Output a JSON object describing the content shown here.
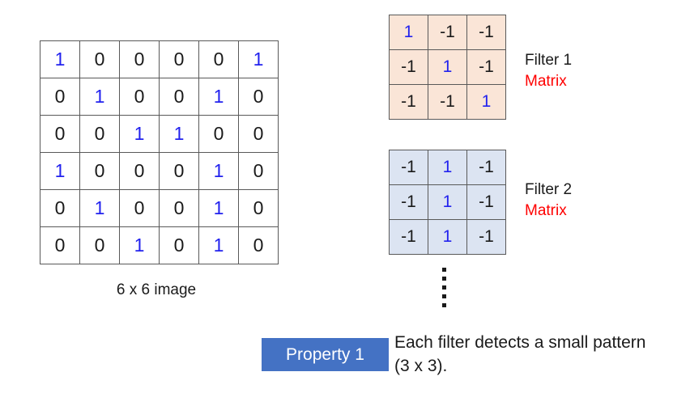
{
  "image_grid": {
    "caption": "6 x 6 image",
    "rows": [
      [
        "1",
        "0",
        "0",
        "0",
        "0",
        "1"
      ],
      [
        "0",
        "1",
        "0",
        "0",
        "1",
        "0"
      ],
      [
        "0",
        "0",
        "1",
        "1",
        "0",
        "0"
      ],
      [
        "1",
        "0",
        "0",
        "0",
        "1",
        "0"
      ],
      [
        "0",
        "1",
        "0",
        "0",
        "1",
        "0"
      ],
      [
        "0",
        "0",
        "1",
        "0",
        "1",
        "0"
      ]
    ]
  },
  "filters": [
    {
      "name": "Filter 1",
      "matrix_label": "Matrix",
      "background_color": "#FAE5D7",
      "rows": [
        [
          "1",
          "-1",
          "-1"
        ],
        [
          "-1",
          "1",
          "-1"
        ],
        [
          "-1",
          "-1",
          "1"
        ]
      ]
    },
    {
      "name": "Filter 2",
      "matrix_label": "Matrix",
      "background_color": "#DCE4F2",
      "rows": [
        [
          "-1",
          "1",
          "-1"
        ],
        [
          "-1",
          "1",
          "-1"
        ],
        [
          "-1",
          "1",
          "-1"
        ]
      ]
    }
  ],
  "ellipsis": {
    "name": "vertical-ellipsis",
    "dot_count": 5
  },
  "property": {
    "badge_label": "Property 1",
    "badge_color": "#4472C4",
    "description": "Each filter detects a small pattern (3 x 3)."
  },
  "colors": {
    "one_value": "#2222ee",
    "zero_value": "#1a1a1a",
    "matrix_label": "#ff0000",
    "grid_border": "#595959"
  }
}
